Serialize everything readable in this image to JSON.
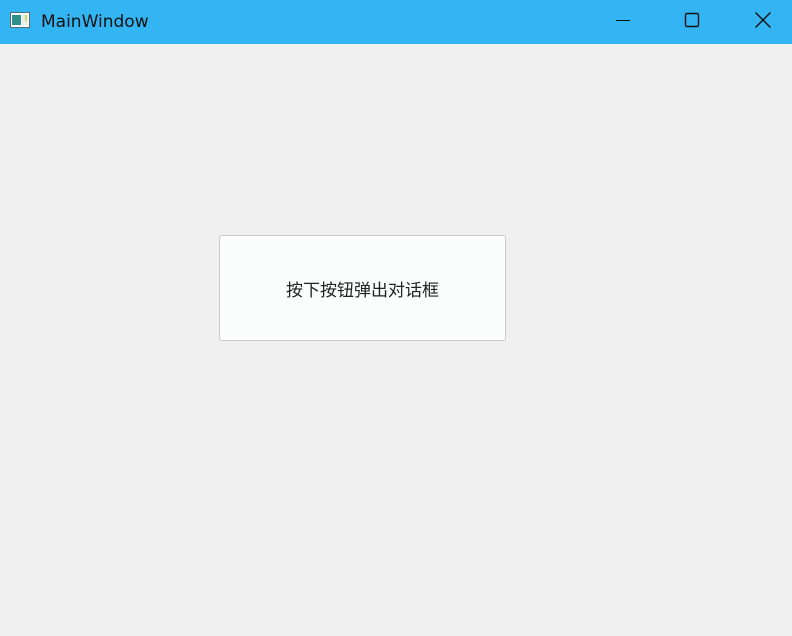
{
  "window": {
    "title": "MainWindow",
    "titlebar_color": "#33b5f3",
    "background_color": "#f0f0f0"
  },
  "titlebar": {
    "app_icon": "window-app-icon",
    "controls": [
      "minimize-icon",
      "maximize-icon",
      "close-icon"
    ]
  },
  "main": {
    "dialog_button_label": "按下按钮弹出对话框"
  }
}
